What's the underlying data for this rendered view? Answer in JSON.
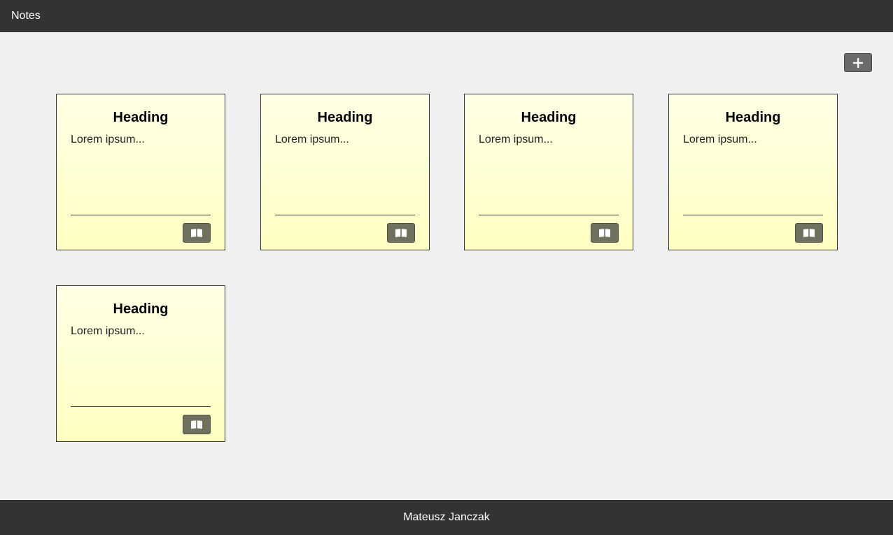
{
  "header": {
    "title": "Notes"
  },
  "toolbar": {
    "add_icon": "plus-icon"
  },
  "notes": [
    {
      "heading": "Heading",
      "body": "Lorem ipsum...",
      "action_icon": "book-open-icon"
    },
    {
      "heading": "Heading",
      "body": "Lorem ipsum...",
      "action_icon": "book-open-icon"
    },
    {
      "heading": "Heading",
      "body": "Lorem ipsum...",
      "action_icon": "book-open-icon"
    },
    {
      "heading": "Heading",
      "body": "Lorem ipsum...",
      "action_icon": "book-open-icon"
    },
    {
      "heading": "Heading",
      "body": "Lorem ipsum...",
      "action_icon": "book-open-icon"
    }
  ],
  "footer": {
    "author": "Mateusz Janczak"
  },
  "colors": {
    "bar_background": "#333333",
    "page_background": "#f0f0f0",
    "note_top": "#ffffe6",
    "note_bottom": "#ffffc2",
    "add_button": "#6b6b6b",
    "read_button": "#70705f"
  }
}
